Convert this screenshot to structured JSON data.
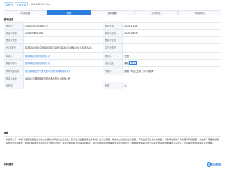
{
  "header": {
    "tag_status": "公开",
    "tag_type": "发明专利",
    "code": "CN120460149A"
  },
  "tabs": [
    {
      "label": "申请信息",
      "active": false
    },
    {
      "label": "摘要",
      "active": true
    },
    {
      "label": "权利要求",
      "active": false
    },
    {
      "label": "法律状态",
      "active": false
    },
    {
      "label": "同族专利",
      "active": false
    }
  ],
  "section_basic": "基本信息",
  "fields": {
    "app_no_label": "申请号",
    "app_no": "CN202510350857.7",
    "app_date_label": "申请日期",
    "app_date": "2025-03-25",
    "pub_no_label": "申请公布号",
    "pub_no": "CN120460149A",
    "pub_date_label": "申请公布日",
    "pub_date": "2025-08-08",
    "grant_no_label": "授权公告号",
    "grant_no": "",
    "grant_date_label": "授权公告日",
    "grant_date": "",
    "ipc_label": "IPC分类号",
    "ipc": "G06Q10/06; G06Q50/06; G06F18/24; G06N3/04; G06N3/08",
    "cpc_label": "CPC分类号",
    "cpc": "",
    "applicant_label": "申请人",
    "applicant": "国网湖北省电力有限公司",
    "country_label": "发明人",
    "country": "王明",
    "orig_applicant_label": "原始申请人",
    "orig_applicant": "国网湖北省电力有限公司",
    "address_label": "地址信息",
    "address": "湖北",
    "address_btn": "查看",
    "agency_label": "专利代理机构",
    "agency": "武汉科皓知识产权代理事务所(特殊普通合伙)",
    "agent_label": "代理人",
    "agent": "张明; 李强; 王芳; 刘洋; 陈静",
    "addr_full_label": "申请人地址",
    "addr_full": "430077 湖北省武汉市武昌区徐东大街341号",
    "priority_label": "优先权",
    "priority": "",
    "pages_label": "页数",
    "pages": "17"
  },
  "section_abstract": "摘要",
  "abstract": "本发明公开一种基于多源数据融合的电力设备状态评估方法及系统，属于电力设备运维技术领域。该方法包括：采集电力设备的运行数据、环境数据与历史检修数据，对多源数据进行预处理与特征提取；构建基于深度神经网络的状态评估模型，利用训练样本对模型进行训练与优化；将实时数据输入训练好的模型，输出设备健康状态等级并生成运维建议。本发明能够提高电力设备状态评估的准确性与实时性，为设备检修决策提供可靠依据。",
  "section_claims": "权利要求",
  "brand": {
    "mark": "企",
    "text": "企查查"
  }
}
